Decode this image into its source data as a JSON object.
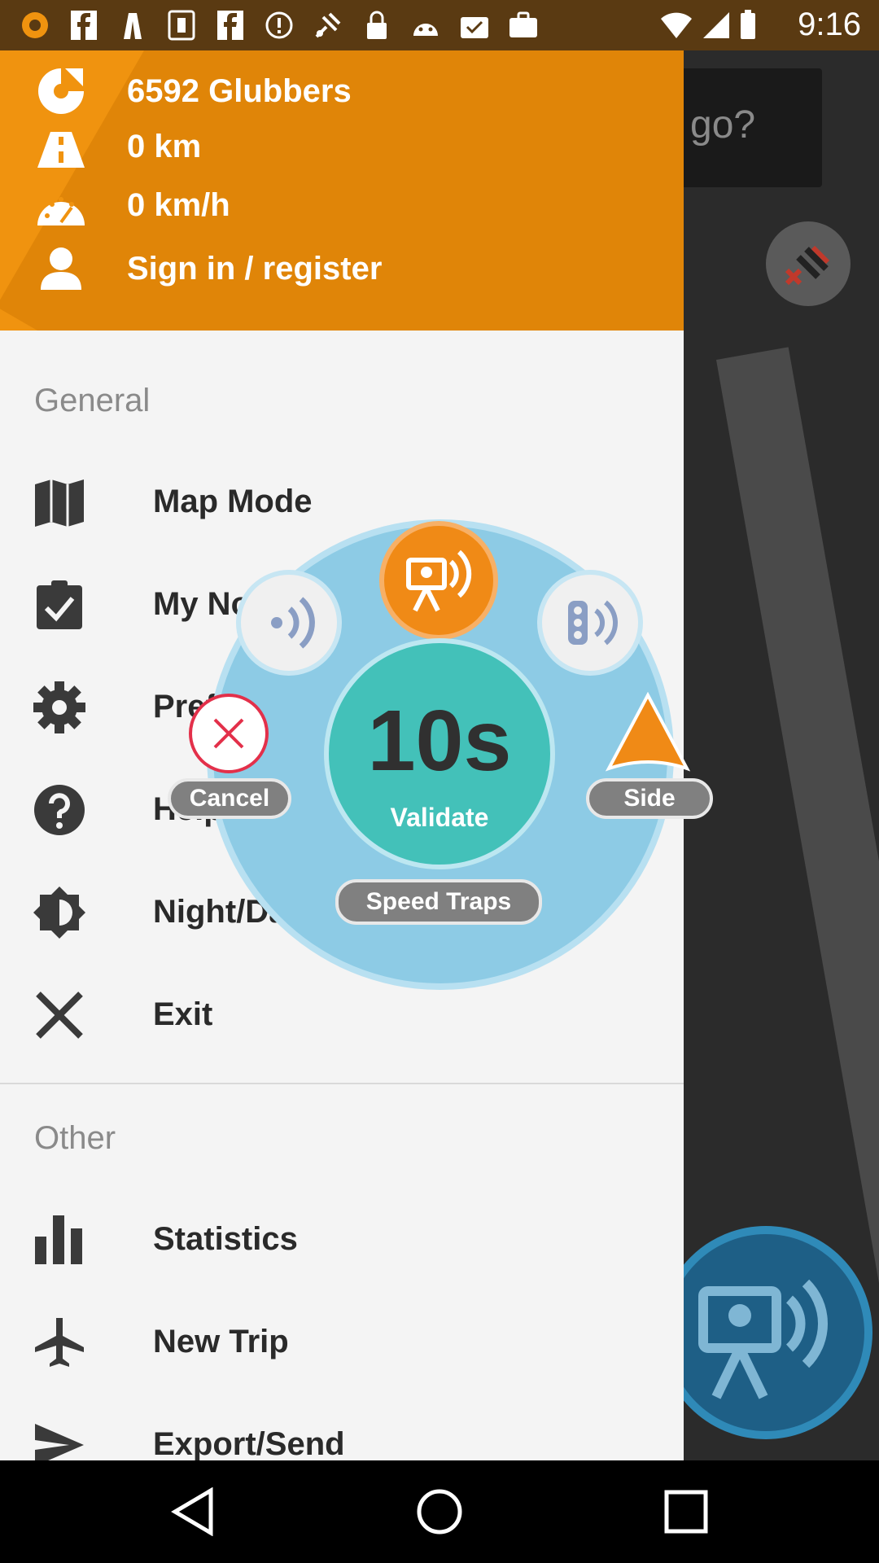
{
  "status_bar": {
    "time": "9:16",
    "left_icons": [
      "app-icon",
      "facebook-icon",
      "signal-icon",
      "game-icon",
      "facebook-icon",
      "info-icon",
      "satellite-icon",
      "lock-icon",
      "android-icon",
      "task-icon",
      "briefcase-icon"
    ]
  },
  "map": {
    "search_placeholder": "go?"
  },
  "header": {
    "points": "6592 Glubbers",
    "distance": "0 km",
    "speed": "0 km/h",
    "sign_in": "Sign in / register"
  },
  "sections": {
    "general": "General",
    "other": "Other"
  },
  "menu_general": [
    {
      "label": "Map Mode",
      "icon": "map-icon"
    },
    {
      "label": "My Notifications",
      "icon": "clipboard-check-icon"
    },
    {
      "label": "Preferences",
      "icon": "gear-icon"
    },
    {
      "label": "Help",
      "icon": "help-icon"
    },
    {
      "label": "Night/Day mode",
      "icon": "night-day-icon"
    },
    {
      "label": "Exit",
      "icon": "close-icon"
    }
  ],
  "menu_other": [
    {
      "label": "Statistics",
      "icon": "bar-chart-icon"
    },
    {
      "label": "New Trip",
      "icon": "airplane-icon"
    },
    {
      "label": "Export/Send",
      "icon": "send-icon"
    }
  ],
  "radial_menu": {
    "countdown": "10s",
    "validate": "Validate",
    "cancel": "Cancel",
    "side": "Side",
    "category": "Speed Traps"
  },
  "colors": {
    "header_orange": "#f0930f",
    "radial_blue": "#8dcbe5",
    "validate_teal": "#43c1b9",
    "accent_orange": "#f08a16"
  }
}
